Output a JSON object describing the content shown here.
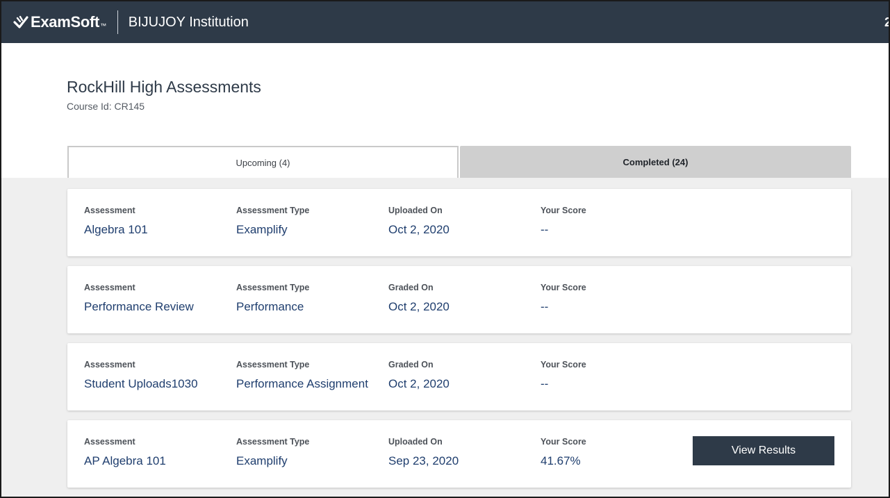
{
  "header": {
    "logo_text": "ExamSoft",
    "trademark": "™",
    "institution": "BIJUJOY Institution",
    "edge_glyph": "2"
  },
  "page": {
    "title": "RockHill High Assessments",
    "course_id": "Course Id: CR145"
  },
  "tabs": [
    {
      "label": "Upcoming (4)",
      "selected": false
    },
    {
      "label": "Completed (24)",
      "selected": true
    }
  ],
  "assessments": [
    {
      "assessment_label": "Assessment",
      "assessment": "Algebra 101",
      "type_label": "Assessment Type",
      "type": "Examplify",
      "date_label": "Uploaded On",
      "date": "Oct 2, 2020",
      "score_label": "Your Score",
      "score": "--"
    },
    {
      "assessment_label": "Assessment",
      "assessment": "Performance Review",
      "type_label": "Assessment Type",
      "type": "Performance",
      "date_label": "Graded On",
      "date": "Oct 2, 2020",
      "score_label": "Your Score",
      "score": "--"
    },
    {
      "assessment_label": "Assessment",
      "assessment": "Student Uploads1030",
      "type_label": "Assessment Type",
      "type": "Performance Assignment",
      "date_label": "Graded On",
      "date": "Oct 2, 2020",
      "score_label": "Your Score",
      "score": "--"
    },
    {
      "assessment_label": "Assessment",
      "assessment": "AP Algebra 101",
      "type_label": "Assessment Type",
      "type": "Examplify",
      "date_label": "Uploaded On",
      "date": "Sep 23, 2020",
      "score_label": "Your Score",
      "score": "41.67%",
      "action_label": "View Results"
    }
  ],
  "colors": {
    "header_bg": "#2e3a48",
    "link_text": "#1f3e6e",
    "content_bg": "#efefef",
    "tab_selected_bg": "#cfcfcf"
  },
  "icons": {
    "logo": "examsoft-logo-icon"
  }
}
